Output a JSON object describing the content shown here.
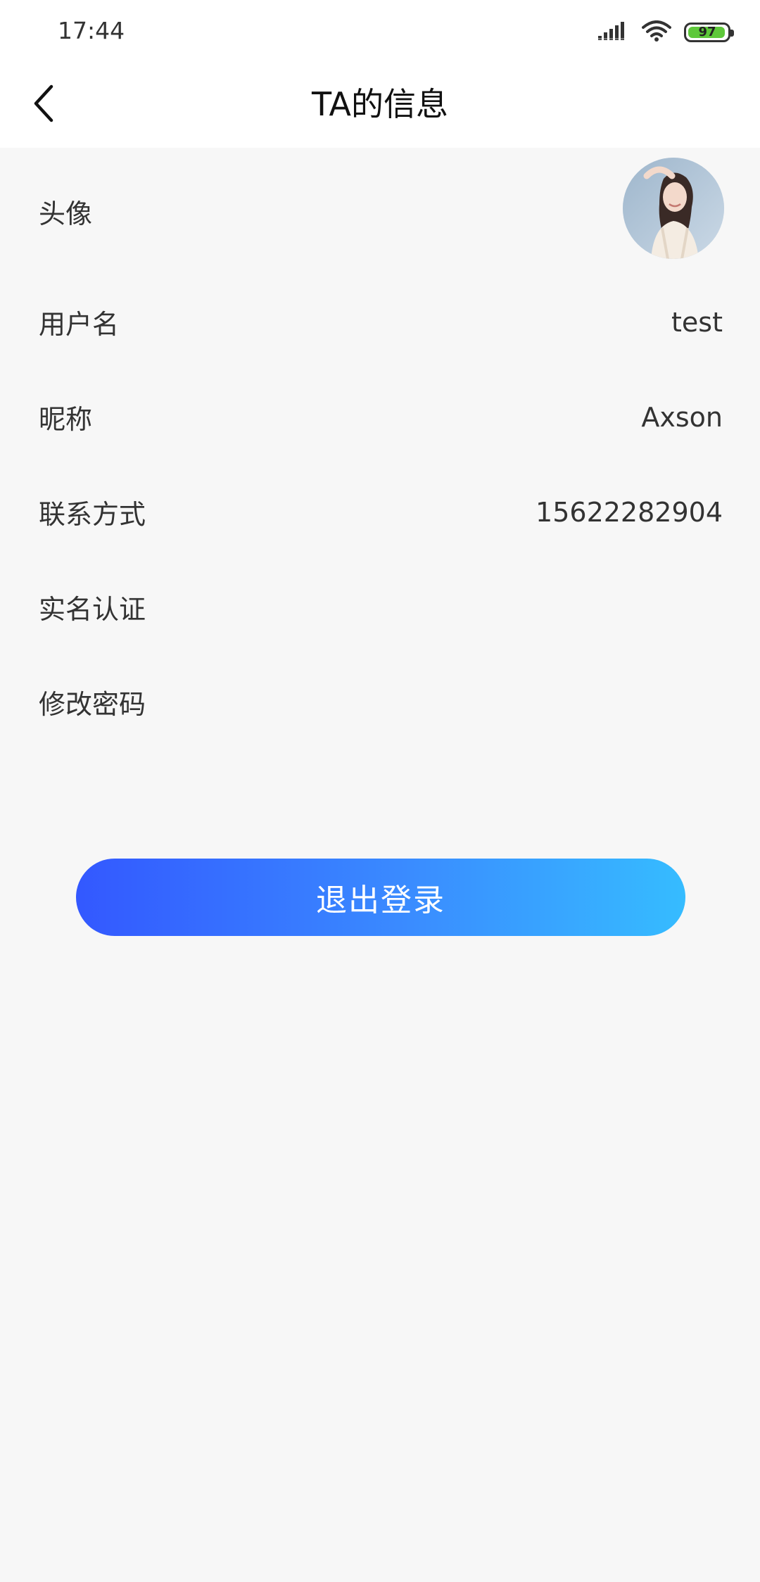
{
  "status_bar": {
    "time": "17:44",
    "battery": "97",
    "battery_level": 0.97,
    "icons": [
      "signal-icon",
      "wifi-icon",
      "battery-icon"
    ]
  },
  "header": {
    "title": "TA的信息",
    "back_icon": "chevron-left-icon"
  },
  "profile": {
    "avatar_label": "头像",
    "username_label": "用户名",
    "username_value": "test",
    "nickname_label": "昵称",
    "nickname_value": "Axson",
    "contact_label": "联系方式",
    "contact_value": "15622282904",
    "realname_label": "实名认证",
    "password_label": "修改密码"
  },
  "logout": {
    "label": "退出登录"
  },
  "colors": {
    "accent_start": "#3358ff",
    "accent_end": "#36bcff",
    "background": "#f7f7f7",
    "battery": "#5ec83a"
  }
}
